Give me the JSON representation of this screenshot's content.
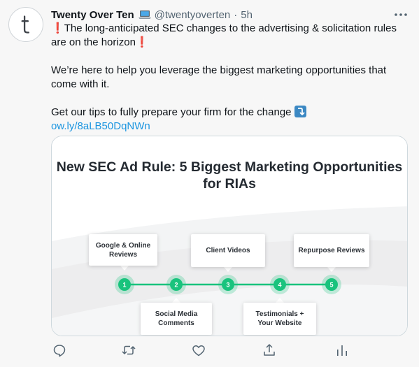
{
  "tweet": {
    "author_name": "Twenty Over Ten",
    "author_emoji": "laptop-icon",
    "handle": "@twentyoverten",
    "separator": "·",
    "timestamp": "5h",
    "body": {
      "line1": "The long-anticipated SEC changes to the advertising & solicitation rules are on the horizon",
      "line2": "We’re here to help you leverage the biggest marketing opportunities that come with it.",
      "line3": "Get our tips to fully prepare your firm for the change",
      "link": "ow.ly/8aLB50DqNWn"
    }
  },
  "card": {
    "title_line1": "New SEC Ad Rule: 5 Biggest Marketing Opportunities",
    "title_line2": "for RIAs",
    "steps": [
      {
        "number": "1",
        "label": "Google & Online Reviews"
      },
      {
        "number": "2",
        "label": "Social Media Comments"
      },
      {
        "number": "3",
        "label": "Client Videos"
      },
      {
        "number": "4",
        "label": "Testimonials + Your Website"
      },
      {
        "number": "5",
        "label": "Repurpose Reviews"
      }
    ]
  },
  "colors": {
    "accent_green": "#19c37d",
    "link_blue": "#1b95e0",
    "exclamation_red": "#dd2e44",
    "muted": "#536471"
  },
  "actions": [
    "reply-icon",
    "retweet-icon",
    "like-icon",
    "share-icon",
    "analytics-icon"
  ]
}
